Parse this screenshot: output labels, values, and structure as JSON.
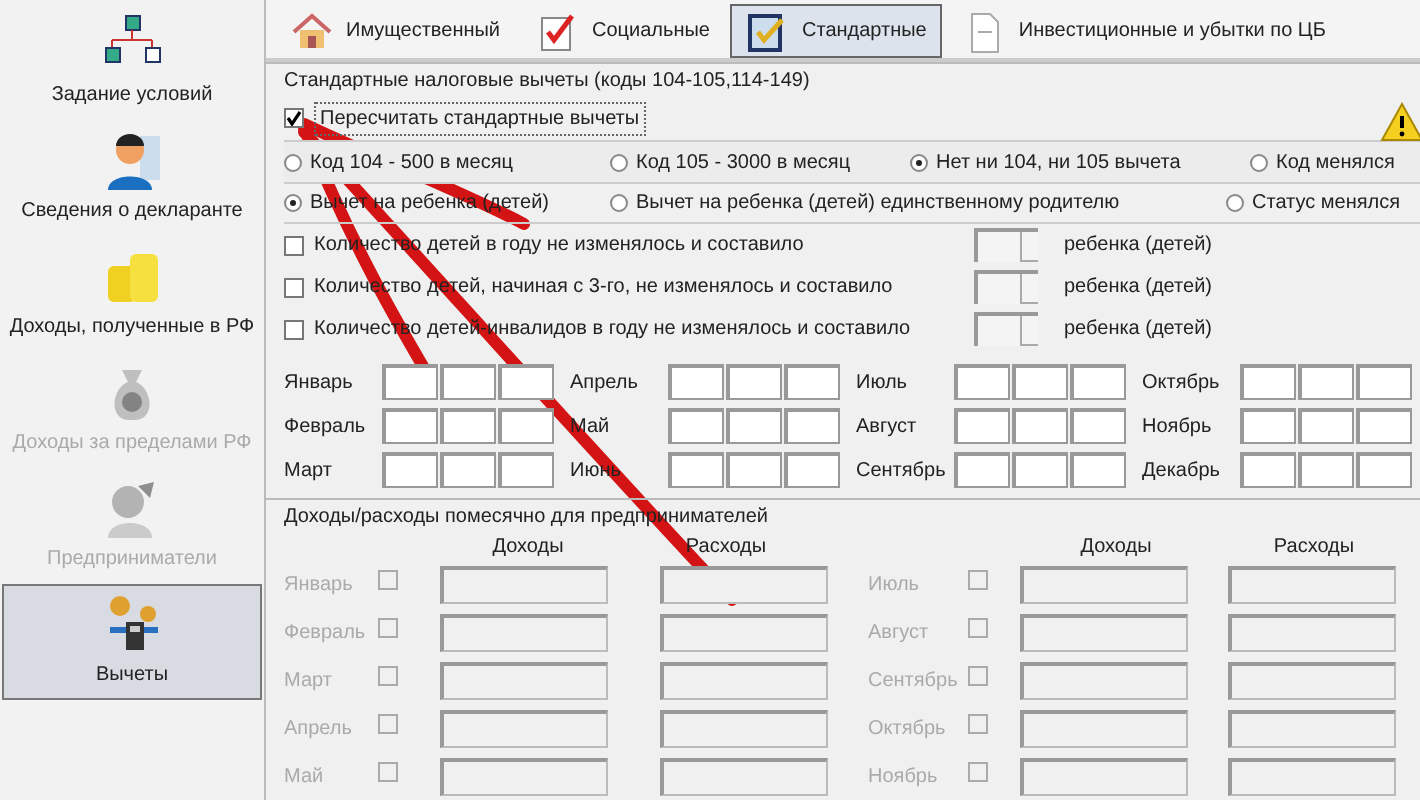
{
  "sidebar": {
    "items": [
      {
        "label": "Задание условий",
        "disabled": false,
        "selected": false
      },
      {
        "label": "Сведения о декларанте",
        "disabled": false,
        "selected": false
      },
      {
        "label": "Доходы, полученные в РФ",
        "disabled": false,
        "selected": false
      },
      {
        "label": "Доходы за пределами РФ",
        "disabled": true,
        "selected": false
      },
      {
        "label": "Предприниматели",
        "disabled": true,
        "selected": false
      },
      {
        "label": "Вычеты",
        "disabled": false,
        "selected": true
      }
    ]
  },
  "tabs": [
    {
      "label": "Имущественный",
      "selected": false
    },
    {
      "label": "Социальные",
      "selected": false
    },
    {
      "label": "Стандартные",
      "selected": true
    },
    {
      "label": "Инвестиционные и убытки по ЦБ",
      "selected": false
    }
  ],
  "standard_deductions": {
    "title": "Стандартные налоговые вычеты (коды 104-105,114-149)",
    "recalculate": {
      "label": "Пересчитать стандартные вычеты",
      "checked": true
    },
    "radio_rows": [
      [
        {
          "label": "Код 104 - 500 в месяц",
          "selected": false
        },
        {
          "label": "Код 105 - 3000 в месяц",
          "selected": false
        },
        {
          "label": "Нет ни 104, ни 105 вычета",
          "selected": true
        },
        {
          "label": "Код менялся",
          "selected": false
        }
      ],
      [
        {
          "label": "Вычет на ребенка (детей)",
          "selected": true
        },
        {
          "label": "Вычет на ребенка (детей) единственному родителю",
          "selected": false
        },
        {
          "label": "Статус менялся",
          "selected": false
        }
      ]
    ],
    "child_rows": [
      {
        "label": "Количество детей в году не изменялось и составило",
        "checked": false,
        "unit": "ребенка (детей)"
      },
      {
        "label": "Количество детей, начиная с 3-го, не изменялось и составило",
        "checked": false,
        "unit": "ребенка (детей)"
      },
      {
        "label": "Количество детей-инвалидов в году не изменялось и составило",
        "checked": false,
        "unit": "ребенка (детей)"
      }
    ],
    "months": [
      "Январь",
      "Февраль",
      "Март",
      "Апрель",
      "Май",
      "Июнь",
      "Июль",
      "Август",
      "Сентябрь",
      "Октябрь",
      "Ноябрь",
      "Декабрь"
    ]
  },
  "entrepreneurs": {
    "title": "Доходы/расходы помесячно для предпринимателей",
    "disabled": true,
    "headers": [
      "Доходы",
      "Расходы",
      "Доходы",
      "Расходы"
    ],
    "left_months": [
      {
        "label": "Январь",
        "checked": false
      },
      {
        "label": "Февраль",
        "checked": false
      },
      {
        "label": "Март",
        "checked": false
      },
      {
        "label": "Апрель",
        "checked": false
      },
      {
        "label": "Май",
        "checked": false
      }
    ],
    "right_months": [
      {
        "label": "Июль",
        "checked": false
      },
      {
        "label": "Август",
        "checked": false
      },
      {
        "label": "Сентябрь",
        "checked": false
      },
      {
        "label": "Октябрь",
        "checked": false
      },
      {
        "label": "Ноябрь",
        "checked": false
      }
    ]
  }
}
